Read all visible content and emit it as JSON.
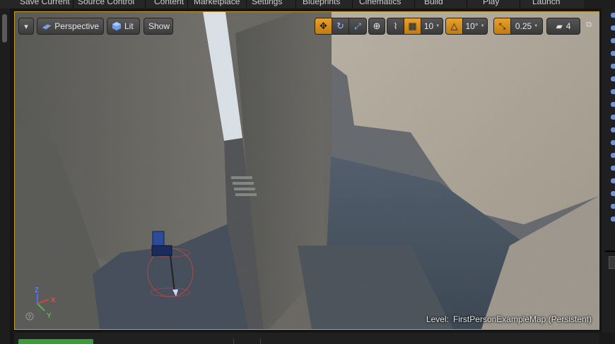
{
  "menu": {
    "items": [
      "Save Current",
      "Source Control",
      "Content",
      "Marketplace",
      "Settings",
      "Blueprints",
      "Cinematics",
      "Build",
      "Play",
      "Launch"
    ]
  },
  "viewport": {
    "view_mode_label": "Perspective",
    "lighting_label": "Lit",
    "show_label": "Show",
    "grid_snap_value": "10",
    "rotation_snap_value": "10°",
    "scale_snap_value": "0.25",
    "camera_speed_value": "4",
    "level_prefix": "Level:",
    "level_name": "FirstPersonExampleMap (Persistent)"
  },
  "axis": {
    "x": "X",
    "y": "Y",
    "z": "Z",
    "help": "?"
  },
  "icons": {
    "dropdown": "chevron-down-icon",
    "perspective": "perspective-cube-icon",
    "lit": "lit-sphere-icon",
    "translate": "translate-icon",
    "rotate": "rotate-icon",
    "scale": "scale-icon",
    "world_local": "world-space-icon",
    "surface_snap": "surface-snap-icon",
    "grid_snap": "grid-snap-icon",
    "rotation_snap": "rotation-snap-icon",
    "scale_snap": "scale-snap-icon",
    "camera_speed": "camera-speed-icon",
    "maximize": "maximize-icon"
  },
  "colors": {
    "viewport_border": "#c99c2e",
    "active_tool": "#e8a12a",
    "outliner_eye": "#7fa7ff",
    "bottom_tab": "#3c9a3c"
  }
}
